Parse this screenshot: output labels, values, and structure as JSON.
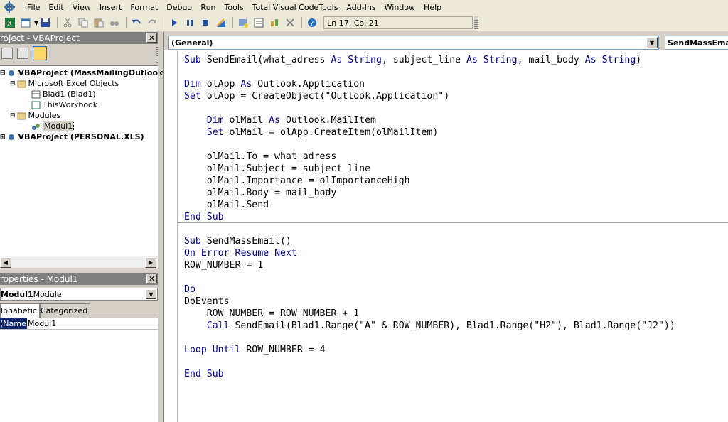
{
  "menu": {
    "items": [
      {
        "label": "File",
        "u": "F",
        "rest": "ile"
      },
      {
        "label": "Edit",
        "u": "E",
        "rest": "dit"
      },
      {
        "label": "View",
        "u": "V",
        "rest": "iew"
      },
      {
        "label": "Insert",
        "u": "I",
        "rest": "nsert"
      },
      {
        "label": "Format",
        "pre": "F",
        "u": "o",
        "rest": "rmat"
      },
      {
        "label": "Debug",
        "u": "D",
        "rest": "ebug"
      },
      {
        "label": "Run",
        "u": "R",
        "rest": "un"
      },
      {
        "label": "Tools",
        "u": "T",
        "rest": "ools"
      },
      {
        "label": "Total Visual CodeTools",
        "pre": "Total Visual ",
        "u": "C",
        "rest": "odeTools"
      },
      {
        "label": "Add-Ins",
        "u": "A",
        "rest": "dd-Ins"
      },
      {
        "label": "Window",
        "u": "W",
        "rest": "indow"
      },
      {
        "label": "Help",
        "u": "H",
        "rest": "elp"
      }
    ]
  },
  "toolbar": {
    "position_text": "Ln 17, Col 21"
  },
  "project": {
    "title": "roject - VBAProject",
    "tree": [
      {
        "text": "VBAProject (MassMailingOutlook.xl",
        "bold": true
      },
      {
        "text": "Microsoft Excel Objects"
      },
      {
        "text": "Blad1 (Blad1)"
      },
      {
        "text": "ThisWorkbook"
      },
      {
        "text": "Modules"
      },
      {
        "text": "Modul1"
      },
      {
        "text": "VBAProject (PERSONAL.XLS)",
        "bold": true
      }
    ]
  },
  "properties": {
    "title": "roperties - Modul1",
    "combo_bold": "Modul1",
    "combo_rest": " Module",
    "tabs": [
      "lphabetic",
      "Categorized"
    ],
    "rows": [
      {
        "name": "(Name)",
        "value": "Modul1"
      }
    ]
  },
  "code": {
    "object_combo": "(General)",
    "proc_combo": "SendMassEmail",
    "lines": [
      "Sub SendEmail(what_adress As String, subject_line As String, mail_body As String)",
      "",
      "Dim olApp As Outlook.Application",
      "Set olApp = CreateObject(\"Outlook.Application\")",
      "",
      "    Dim olMail As Outlook.MailItem",
      "    Set olMail = olApp.CreateItem(olMailItem)",
      "",
      "    olMail.To = what_adress",
      "    olMail.Subject = subject_line",
      "    olMail.Importance = olImportanceHigh",
      "    olMail.Body = mail_body",
      "    olMail.Send",
      "End Sub",
      "",
      "Sub SendMassEmail()",
      "On Error Resume Next",
      "ROW_NUMBER = 1",
      "",
      "Do",
      "DoEvents",
      "    ROW_NUMBER = ROW_NUMBER + 1",
      "    Call SendEmail(Blad1.Range(\"A\" & ROW_NUMBER), Blad1.Range(\"H2\"), Blad1.Range(\"J2\"))",
      "",
      "Loop Until ROW_NUMBER = 4",
      "",
      "End Sub"
    ],
    "keyword_color": "#00008b"
  },
  "icons": [
    "app-icon",
    "excel-icon",
    "insert-module-icon",
    "save-icon",
    "cut-icon",
    "copy-icon",
    "paste-icon",
    "find-icon",
    "undo-icon",
    "redo-icon",
    "run-icon",
    "break-icon",
    "reset-icon",
    "design-mode-icon",
    "project-explorer-icon",
    "properties-icon",
    "object-browser-icon",
    "toolbox-icon",
    "help-icon"
  ]
}
